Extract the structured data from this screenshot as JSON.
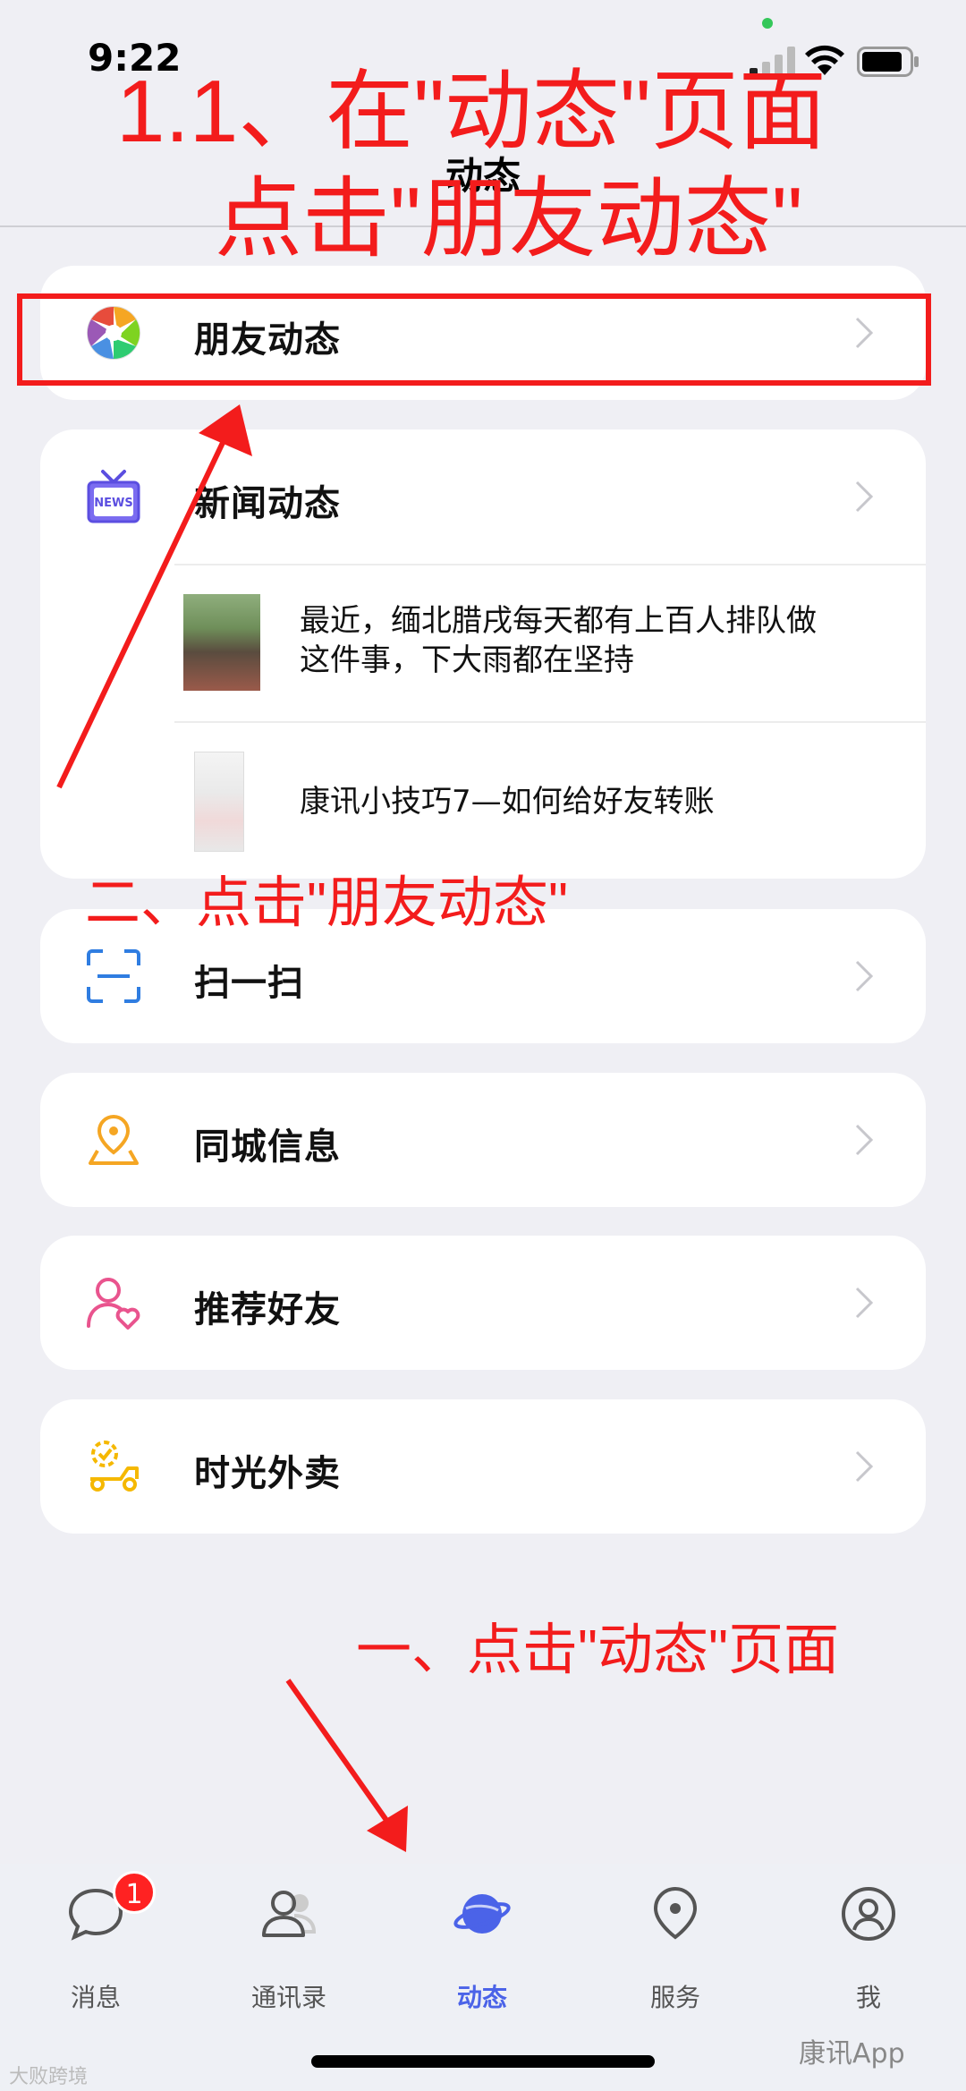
{
  "status_bar": {
    "time": "9:22"
  },
  "nav": {
    "title": "动态"
  },
  "cards": {
    "friends": {
      "label": "朋友动态"
    },
    "news": {
      "label": "新闻动态",
      "items": [
        {
          "line1": "最近，缅北腊戌每天都有上百人排队做",
          "line2": "这件事，下大雨都在坚持"
        },
        {
          "line1": "康讯小技巧7—如何给好友转账",
          "line2": ""
        }
      ]
    },
    "scan": {
      "label": "扫一扫"
    },
    "city": {
      "label": "同城信息"
    },
    "recommend": {
      "label": "推荐好友"
    },
    "takeout": {
      "label": "时光外卖"
    }
  },
  "annotations": {
    "step_1_1_line1": "1.1、在\"动态\"页面",
    "step_1_1_line2": "点击\"朋友动态\"",
    "step_2": "二、点击\"朋友动态\"",
    "step_1": "一、点击\"动态\"页面"
  },
  "tab_bar": {
    "tabs": [
      {
        "label": "消息",
        "icon": "chat-bubble-icon",
        "badge": "1"
      },
      {
        "label": "通讯录",
        "icon": "contacts-icon"
      },
      {
        "label": "动态",
        "icon": "planet-icon",
        "active": true
      },
      {
        "label": "服务",
        "icon": "location-pin-icon"
      },
      {
        "label": "我",
        "icon": "profile-icon"
      }
    ]
  },
  "watermarks": {
    "left": "大败跨境",
    "right": "康讯App"
  },
  "colors": {
    "accent": "#4b63e8",
    "annotation_red": "#f31c1c",
    "background": "#efeff4",
    "badge_red": "#ff2222"
  }
}
